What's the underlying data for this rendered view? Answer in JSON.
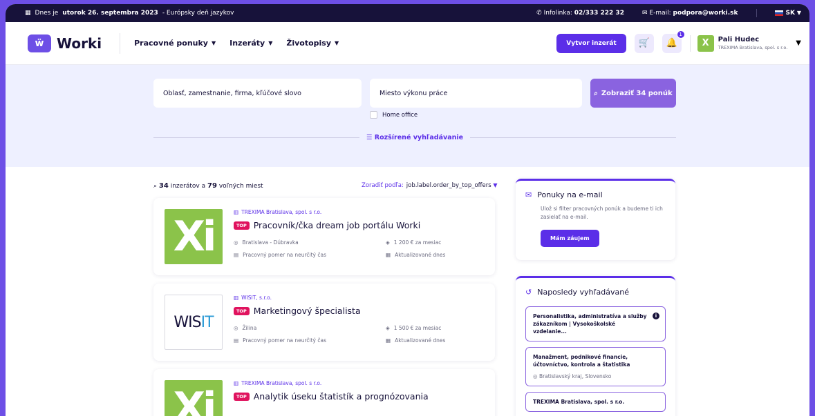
{
  "topbar": {
    "date_prefix": "Dnes je",
    "date_value": "utorok 26. septembra 2023",
    "date_suffix": "- Európsky deň jazykov",
    "infolinka_label": "Infolinka:",
    "infolinka_value": "02/333 222 32",
    "email_label": "E-mail:",
    "email_value": "podpora@worki.sk",
    "lang": "SK"
  },
  "header": {
    "logo": "Worki",
    "nav": [
      "Pracovné ponuky",
      "Inzeráty",
      "Životopisy"
    ],
    "create_button": "Vytvor inzerát",
    "notif_count": "1",
    "user_name": "Pali Hudec",
    "user_company": "TREXIMA Bratislava, spol. s r.o."
  },
  "search": {
    "keyword_placeholder": "Oblasť, zamestnanie, firma, kľúčové slovo",
    "location_placeholder": "Miesto výkonu práce",
    "button": "Zobraziť 34 ponúk",
    "home_office": "Home office",
    "advanced": "Rozšírené vyhľadávanie"
  },
  "results": {
    "ads_count": "34",
    "ads_label": "inzerátov a",
    "places_count": "79",
    "places_label": "voľných miest",
    "sort_label": "Zoradiť podľa:",
    "sort_value": "job.label.order_by_top_offers"
  },
  "jobs": [
    {
      "company": "TREXIMA Bratislava, spol. s r.o.",
      "badge": "TOP",
      "title": "Pracovník/čka dream job portálu Worki",
      "location": "Bratislava - Dúbravka",
      "salary": "1 200 € za mesiac",
      "contract": "Pracovný pomer na neurčitý čas",
      "updated": "Aktualizované dnes"
    },
    {
      "company": "WISIT, s.r.o.",
      "badge": "TOP",
      "title": "Marketingový špecialista",
      "location": "Žilina",
      "salary": "1 500 € za mesiac",
      "contract": "Pracovný pomer na neurčitý čas",
      "updated": "Aktualizované dnes"
    },
    {
      "company": "TREXIMA Bratislava, spol. s r.o.",
      "badge": "TOP",
      "title": "Analytik úseku štatistík a prognózovania"
    }
  ],
  "email_box": {
    "title": "Ponuky na e-mail",
    "text": "Ulož si filter pracovných ponúk a budeme ti ich zasielať na e-mail.",
    "button": "Mám záujem"
  },
  "recent": {
    "title": "Naposledy vyhľadávané",
    "items": [
      {
        "text": "Personalistika, administratíva a služby zákazníkom | Vysokoškolské vzdelanie..."
      },
      {
        "text": "Manažment, podnikové financie, účtovníctvo, kontrola a štatistika",
        "location": "Bratislavský kraj, Slovensko"
      },
      {
        "text": "TREXIMA Bratislava, spol. s r.o."
      }
    ]
  },
  "logos": {
    "xi": "Xi",
    "wisit_a": "WIS",
    "wisit_b": "IT"
  }
}
